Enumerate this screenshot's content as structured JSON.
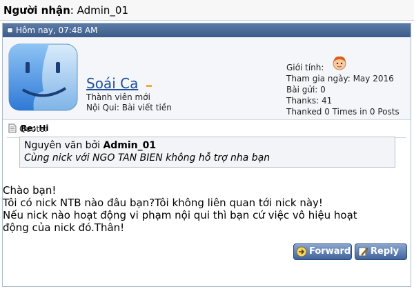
{
  "recipient": {
    "label": "Người nhận",
    "value": "Admin_01"
  },
  "message": {
    "date": "Hôm nay, 07:48 AM",
    "author": {
      "name": "Soái Ca",
      "rank": "Thành viên mới",
      "rules": "Nội Qui: Bài viết tiền"
    },
    "stats": {
      "gender": "Giới tính:",
      "joined": "Tham gia ngày: May 2016",
      "posts": "Bài gửi: 0",
      "thanks": "Thanks: 41",
      "thanked": "Thanked 0 Times in 0 Posts"
    },
    "title": "Re: Hi",
    "quote": {
      "label": "Quote:",
      "prefix": "Nguyên văn bởi",
      "author": "Admin_01",
      "text": "Cùng nick với NGO TAN BIEN không hỗ trợ nha bạn"
    },
    "body": [
      "Chào bạn!",
      "Tôi có nick NTB nào đâu bạn?Tôi không liên quan tới nick này!",
      "Nếu nick nào hoạt động vi phạm nội qui thì bạn cứ việc vô hiệu hoạt",
      "động của nick đó.Thân!"
    ]
  },
  "actions": {
    "forward": "Forward",
    "reply": "Reply"
  },
  "colors": {
    "header_blue": "#3c5b8a",
    "link_blue": "#1b4f9e",
    "button_blue": "#3f639d"
  }
}
